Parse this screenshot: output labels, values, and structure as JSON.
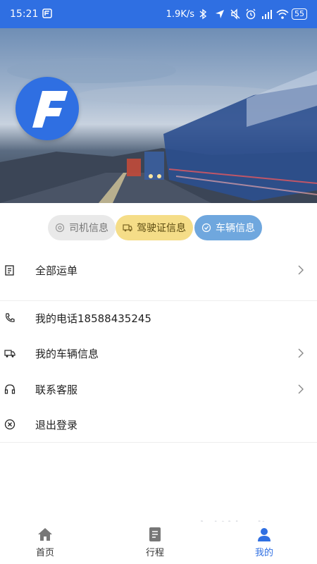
{
  "status_bar": {
    "time": "15:21",
    "network_speed": "1.9K/s",
    "battery": "55",
    "icons": [
      "app-notification-icon",
      "bluetooth-icon",
      "location-icon",
      "mute-icon",
      "alarm-icon",
      "hd-signal-icon",
      "wifi-icon",
      "battery-icon"
    ]
  },
  "hero": {
    "logo_icon": "brand-f-logo-icon",
    "background": "highway-trucks-photo"
  },
  "tabs": [
    {
      "label": "司机信息",
      "icon": "settings-icon",
      "color": "#e9e9e9"
    },
    {
      "label": "驾驶证信息",
      "icon": "truck-icon",
      "color": "#f5dd88"
    },
    {
      "label": "车辆信息",
      "icon": "check-circle-icon",
      "color": "#6fa7de"
    }
  ],
  "menu": [
    {
      "label": "全部运单",
      "icon": "document-icon",
      "has_chevron": true
    },
    {
      "label": "我的电话18588435245",
      "icon": "phone-icon",
      "has_chevron": false
    },
    {
      "label": "我的车辆信息",
      "icon": "truck-icon",
      "has_chevron": true
    },
    {
      "label": "联系客服",
      "icon": "headset-icon",
      "has_chevron": true
    },
    {
      "label": "退出登录",
      "icon": "close-circle-icon",
      "has_chevron": false
    }
  ],
  "bottom_nav": [
    {
      "label": "首页",
      "icon": "home-icon",
      "active": false
    },
    {
      "label": "行程",
      "icon": "list-icon",
      "active": false
    },
    {
      "label": "我的",
      "icon": "user-icon",
      "active": true
    }
  ],
  "watermark": {
    "text": "一刻游戏网",
    "sub": "yx.com"
  },
  "colors": {
    "accent": "#2f6fe2",
    "driver_tab": "#e9e9e9",
    "license_tab": "#f5dd88",
    "vehicle_tab": "#6fa7de"
  }
}
